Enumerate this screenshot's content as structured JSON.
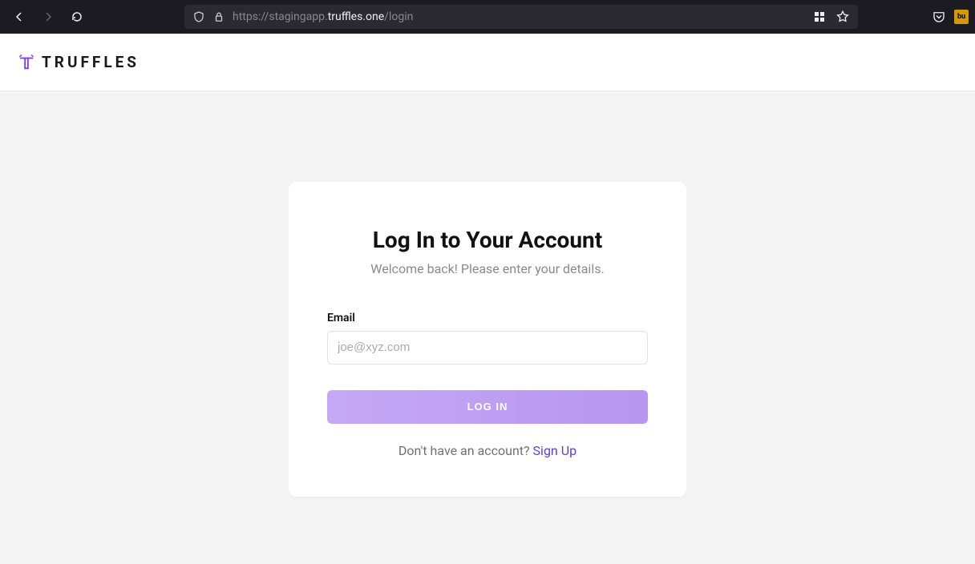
{
  "browser": {
    "url_prefix": "https://stagingapp.",
    "url_domain": "truffles.one",
    "url_path": "/login"
  },
  "header": {
    "brand": "TRUFFLES"
  },
  "login": {
    "title": "Log In to Your Account",
    "subtitle": "Welcome back! Please enter your details.",
    "email_label": "Email",
    "email_placeholder": "joe@xyz.com",
    "button_label": "LOG IN",
    "signup_prompt": "Don't have an account? ",
    "signup_link": "Sign Up"
  }
}
